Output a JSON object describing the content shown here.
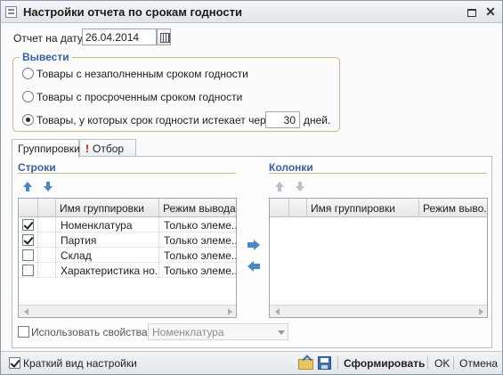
{
  "window": {
    "title": "Настройки отчета по срокам годности",
    "menu_icon": "list-icon",
    "maximize_icon": "maximize-icon",
    "close_icon": "close-icon"
  },
  "report_date": {
    "label": "Отчет на дату:",
    "value": "26.04.2014"
  },
  "output": {
    "title": "Вывести",
    "options": [
      {
        "label": "Товары с незаполненным сроком годности",
        "selected": false
      },
      {
        "label": "Товары с просроченным сроком годности",
        "selected": false
      },
      {
        "label": "Товары, у которых срок годности истекает через:",
        "selected": true
      }
    ],
    "days_value": "30",
    "days_label": "дней."
  },
  "tabs": [
    {
      "label": "Группировки",
      "active": true
    },
    {
      "label": "Отбор",
      "active": false,
      "marker": "!"
    }
  ],
  "rows_section": {
    "title": "Строки",
    "columns": [
      "Имя группировки",
      "Режим вывода"
    ],
    "items": [
      {
        "checked": true,
        "name": "Номенклатура",
        "mode": "Только элеме..."
      },
      {
        "checked": true,
        "name": "Партия",
        "mode": "Только элеме..."
      },
      {
        "checked": false,
        "name": "Склад",
        "mode": "Только элеме..."
      },
      {
        "checked": false,
        "name": "Характеристика но...",
        "mode": "Только элеме..."
      }
    ]
  },
  "columns_section": {
    "title": "Колонки",
    "columns": [
      "Имя группировки",
      "Режим выво..."
    ],
    "items": []
  },
  "use_properties": {
    "label": "Использовать свойства",
    "checked": false,
    "select_value": "Номенклатура"
  },
  "bottom_bar": {
    "short_view_label": "Краткий вид настройки",
    "short_view_checked": true,
    "generate_label": "Сформировать",
    "ok_label": "OK",
    "cancel_label": "Отмена"
  },
  "colors": {
    "section_title": "#3a5fa8",
    "accent_arrow": "#4b86c6",
    "tab_marker": "#d00000"
  }
}
